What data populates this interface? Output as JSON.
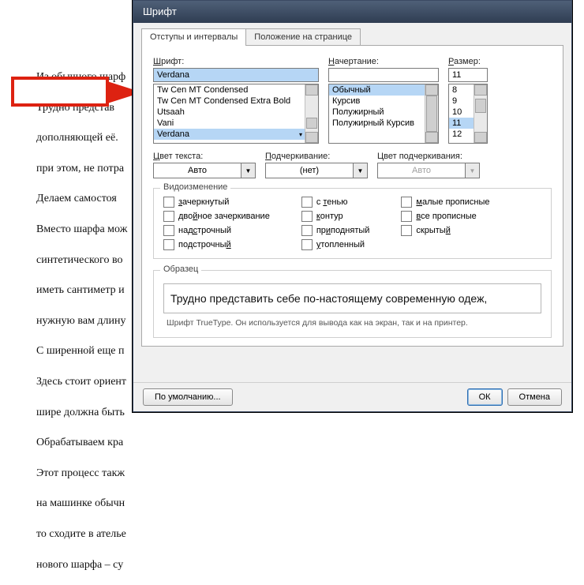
{
  "document": {
    "lines": [
      "Из обычного шарф",
      "Трудно представ",
      "дополняющей её.",
      "при этом, не потра",
      "Делаем самостоя",
      "Вместо шарфа мож",
      "синтетического во",
      "иметь сантиметр и",
      "нужную вам длину",
      " С ширенной еще п",
      "Здесь стоит ориент",
      "шире должна быть",
      "Обрабатываем кра",
      "Этот процесс такж",
      "на машинке обычн",
      "то сходите в ателье",
      "нового шарфа – су"
    ]
  },
  "dialog": {
    "title": "Шрифт",
    "tabs": {
      "indent": "Отступы и интервалы",
      "position": "Положение на странице"
    },
    "fontLabel": "Шрифт:",
    "fontValue": "Verdana",
    "fontList": [
      "Tw Cen MT Condensed",
      "Tw Cen MT Condensed Extra Bold",
      "Utsaah",
      "Vani",
      "Verdana"
    ],
    "styleLabel": "Начертание:",
    "styleValue": "",
    "styleList": [
      "Обычный",
      "Курсив",
      "Полужирный",
      "Полужирный Курсив"
    ],
    "sizeLabel": "Размер:",
    "sizeValue": "11",
    "sizeList": [
      "8",
      "9",
      "10",
      "11",
      "12"
    ],
    "textColorLabel": "Цвет текста:",
    "textColorValue": "Авто",
    "underlineLabel": "Подчеркивание:",
    "underlineValue": "(нет)",
    "ulColorLabel": "Цвет подчеркивания:",
    "ulColorValue": "Авто",
    "effectsLegend": "Видоизменение",
    "cb": {
      "strike": "зачеркнутый",
      "dstrike": "двойное зачеркивание",
      "sup": "надстрочный",
      "sub": "подстрочный",
      "shadow": "с тенью",
      "outline": "контур",
      "raised": "приподнятый",
      "sunk": "утопленный",
      "scaps": "малые прописные",
      "caps": "все прописные",
      "hidden": "скрытый"
    },
    "sampleLegend": "Образец",
    "sampleText": "Трудно представить себе по-настоящему современную одеж,",
    "hint": "Шрифт TrueType. Он используется для вывода как на экран, так и на принтер.",
    "buttons": {
      "default": "По умолчанию...",
      "ok": "ОК",
      "cancel": "Отмена"
    }
  }
}
